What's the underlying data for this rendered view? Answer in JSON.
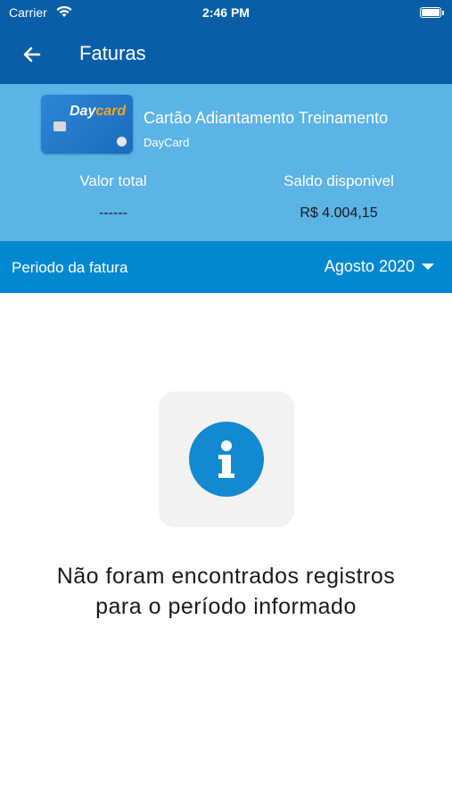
{
  "status_bar": {
    "carrier": "Carrier",
    "time": "2:46 PM"
  },
  "app_bar": {
    "title": "Faturas"
  },
  "card": {
    "logo_day": "Day",
    "logo_card": "card",
    "name": "Cartão Adiantamento Treinamento",
    "brand": "DayCard"
  },
  "summary": {
    "total_label": "Valor total",
    "total_value": "------",
    "saldo_label": "Saldo disponivel",
    "saldo_value": "R$ 4.004,15"
  },
  "period": {
    "label": "Periodo da fatura",
    "selected": "Agosto 2020"
  },
  "empty_state": {
    "line1": "Não foram encontrados registros",
    "line2": "para o período informado"
  },
  "colors": {
    "app_bar": "#0a5ea8",
    "card_panel": "#5bb3e6",
    "period_bar": "#0288d1",
    "info_icon": "#1289d1"
  },
  "icons": {
    "back": "arrow-left-icon",
    "dropdown": "caret-down-icon",
    "info": "info-icon"
  }
}
